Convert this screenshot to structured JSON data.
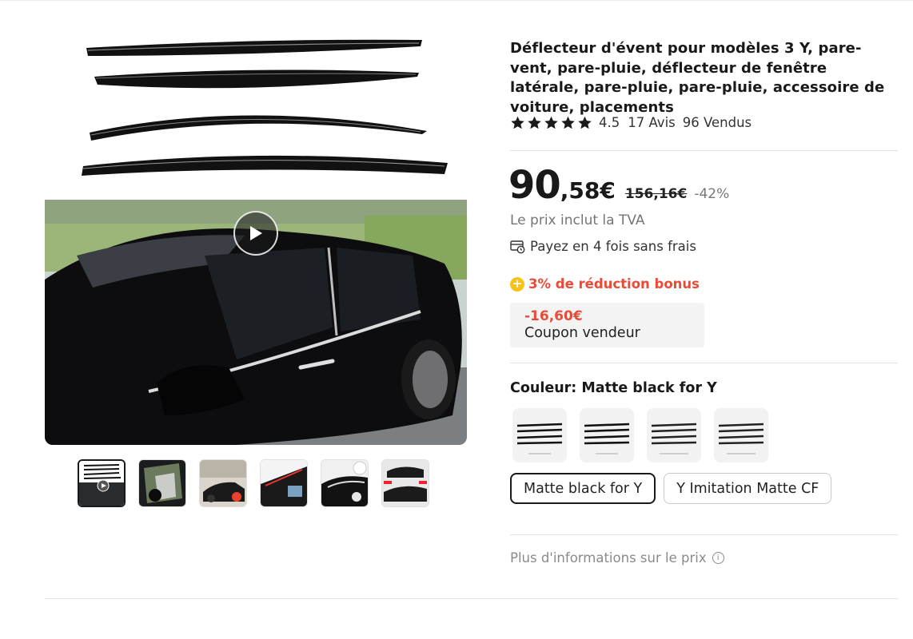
{
  "product": {
    "title": "Déflecteur d'évent pour modèles 3 Y, pare-vent, pare-pluie, déflecteur de fenêtre latérale, pare-pluie, pare-pluie, accessoire de voiture, placements",
    "rating": "4.5",
    "rating_value": 4.5,
    "reviews": "17 Avis",
    "sold": "96 Vendus"
  },
  "price": {
    "integer": "90",
    "decimal": ",58€",
    "original": "156,16€",
    "discount": "-42%",
    "vat_note": "Le prix inclut la TVA",
    "installments": "Payez en 4 fois sans frais"
  },
  "promo": {
    "bonus_icon": "+",
    "bonus": "3% de réduction bonus",
    "coupon_amount": "-16,60€",
    "coupon_label": "Coupon vendeur"
  },
  "variants": {
    "label": "Couleur: Matte black for Y",
    "options": [
      "Matte black for Y",
      "Y Imitation Matte CF"
    ]
  },
  "more_info": "Plus d'informations sur le prix",
  "icons": {
    "star": "star-icon",
    "play": "play-icon",
    "installment": "payment-card-icon",
    "bonus": "plus-coin-icon",
    "info": "info-icon"
  },
  "colors": {
    "accent_red": "#ea4a36",
    "bonus_yellow": "#f7c21a",
    "text": "#191919"
  }
}
